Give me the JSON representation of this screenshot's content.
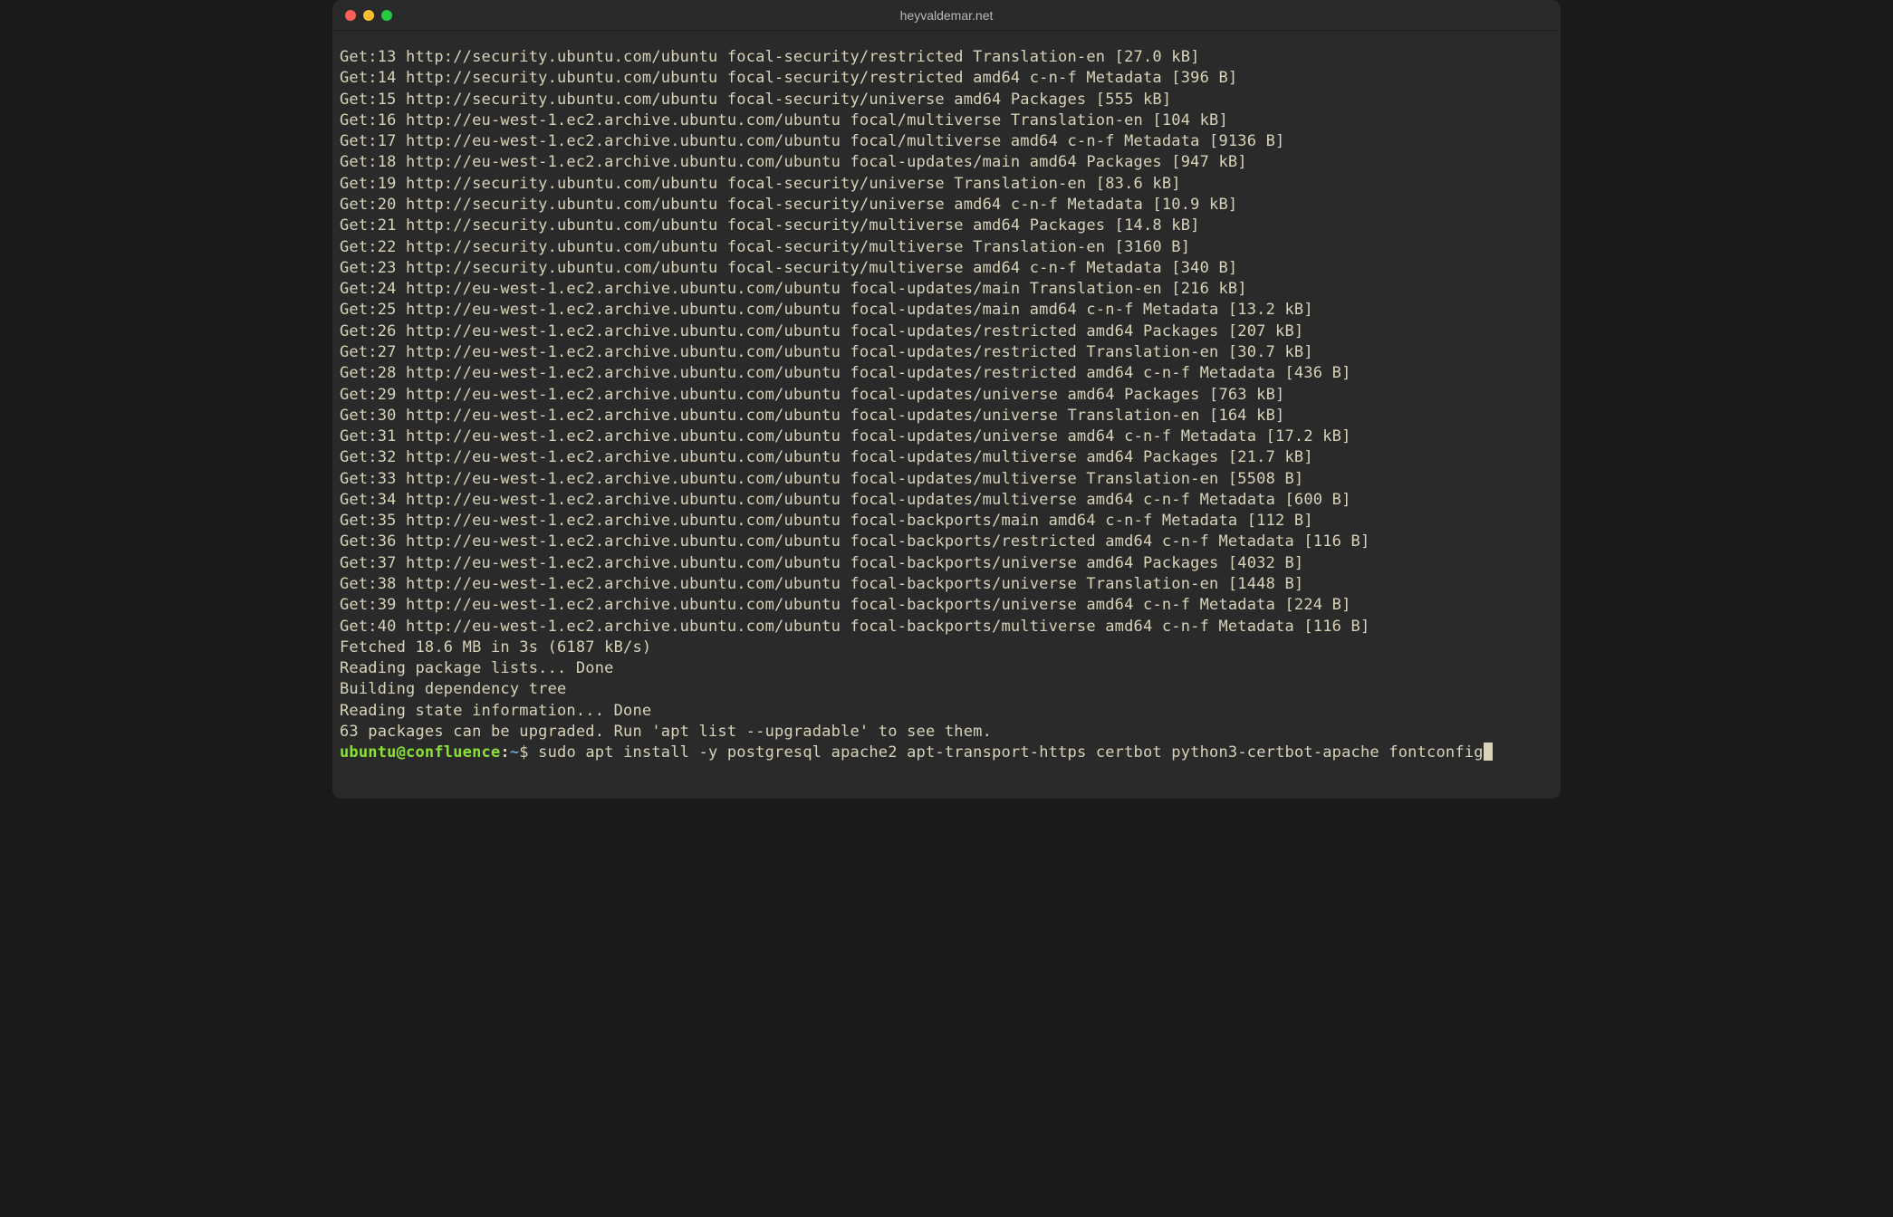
{
  "window": {
    "title": "heyvaldemar.net"
  },
  "terminal": {
    "lines": [
      "Get:13 http://security.ubuntu.com/ubuntu focal-security/restricted Translation-en [27.0 kB]",
      "Get:14 http://security.ubuntu.com/ubuntu focal-security/restricted amd64 c-n-f Metadata [396 B]",
      "Get:15 http://security.ubuntu.com/ubuntu focal-security/universe amd64 Packages [555 kB]",
      "Get:16 http://eu-west-1.ec2.archive.ubuntu.com/ubuntu focal/multiverse Translation-en [104 kB]",
      "Get:17 http://eu-west-1.ec2.archive.ubuntu.com/ubuntu focal/multiverse amd64 c-n-f Metadata [9136 B]",
      "Get:18 http://eu-west-1.ec2.archive.ubuntu.com/ubuntu focal-updates/main amd64 Packages [947 kB]",
      "Get:19 http://security.ubuntu.com/ubuntu focal-security/universe Translation-en [83.6 kB]",
      "Get:20 http://security.ubuntu.com/ubuntu focal-security/universe amd64 c-n-f Metadata [10.9 kB]",
      "Get:21 http://security.ubuntu.com/ubuntu focal-security/multiverse amd64 Packages [14.8 kB]",
      "Get:22 http://security.ubuntu.com/ubuntu focal-security/multiverse Translation-en [3160 B]",
      "Get:23 http://security.ubuntu.com/ubuntu focal-security/multiverse amd64 c-n-f Metadata [340 B]",
      "Get:24 http://eu-west-1.ec2.archive.ubuntu.com/ubuntu focal-updates/main Translation-en [216 kB]",
      "Get:25 http://eu-west-1.ec2.archive.ubuntu.com/ubuntu focal-updates/main amd64 c-n-f Metadata [13.2 kB]",
      "Get:26 http://eu-west-1.ec2.archive.ubuntu.com/ubuntu focal-updates/restricted amd64 Packages [207 kB]",
      "Get:27 http://eu-west-1.ec2.archive.ubuntu.com/ubuntu focal-updates/restricted Translation-en [30.7 kB]",
      "Get:28 http://eu-west-1.ec2.archive.ubuntu.com/ubuntu focal-updates/restricted amd64 c-n-f Metadata [436 B]",
      "Get:29 http://eu-west-1.ec2.archive.ubuntu.com/ubuntu focal-updates/universe amd64 Packages [763 kB]",
      "Get:30 http://eu-west-1.ec2.archive.ubuntu.com/ubuntu focal-updates/universe Translation-en [164 kB]",
      "Get:31 http://eu-west-1.ec2.archive.ubuntu.com/ubuntu focal-updates/universe amd64 c-n-f Metadata [17.2 kB]",
      "Get:32 http://eu-west-1.ec2.archive.ubuntu.com/ubuntu focal-updates/multiverse amd64 Packages [21.7 kB]",
      "Get:33 http://eu-west-1.ec2.archive.ubuntu.com/ubuntu focal-updates/multiverse Translation-en [5508 B]",
      "Get:34 http://eu-west-1.ec2.archive.ubuntu.com/ubuntu focal-updates/multiverse amd64 c-n-f Metadata [600 B]",
      "Get:35 http://eu-west-1.ec2.archive.ubuntu.com/ubuntu focal-backports/main amd64 c-n-f Metadata [112 B]",
      "Get:36 http://eu-west-1.ec2.archive.ubuntu.com/ubuntu focal-backports/restricted amd64 c-n-f Metadata [116 B]",
      "Get:37 http://eu-west-1.ec2.archive.ubuntu.com/ubuntu focal-backports/universe amd64 Packages [4032 B]",
      "Get:38 http://eu-west-1.ec2.archive.ubuntu.com/ubuntu focal-backports/universe Translation-en [1448 B]",
      "Get:39 http://eu-west-1.ec2.archive.ubuntu.com/ubuntu focal-backports/universe amd64 c-n-f Metadata [224 B]",
      "Get:40 http://eu-west-1.ec2.archive.ubuntu.com/ubuntu focal-backports/multiverse amd64 c-n-f Metadata [116 B]",
      "Fetched 18.6 MB in 3s (6187 kB/s)",
      "Reading package lists... Done",
      "Building dependency tree",
      "Reading state information... Done",
      "63 packages can be upgraded. Run 'apt list --upgradable' to see them."
    ],
    "prompt": {
      "user_host": "ubuntu@confluence",
      "colon": ":",
      "path": "~",
      "dollar": "$ ",
      "command": "sudo apt install -y postgresql apache2 apt-transport-https certbot python3-certbot-apache fontconfig"
    }
  }
}
